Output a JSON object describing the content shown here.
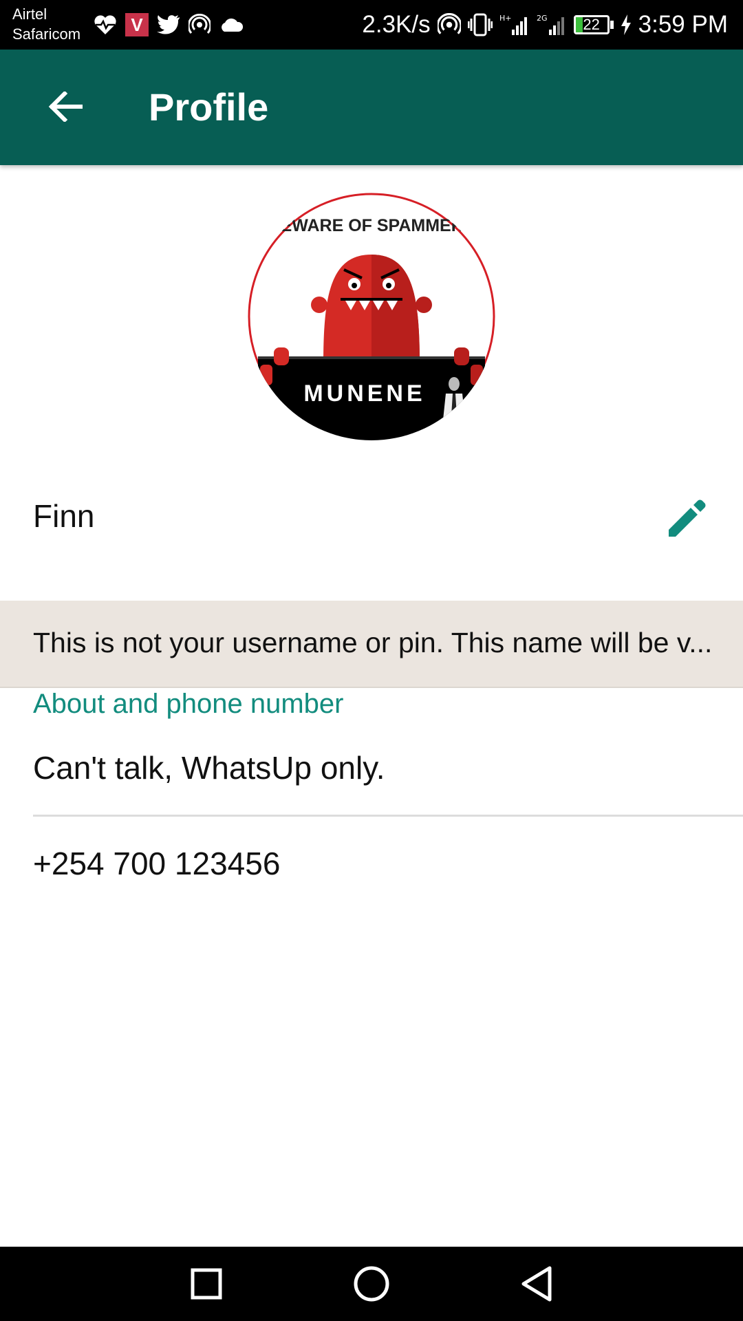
{
  "status_bar": {
    "carrier_1": "Airtel",
    "carrier_2": "Safaricom",
    "net_speed": "2.3K/s",
    "battery": "22",
    "battery_level_percent": 22,
    "time": "3:59 PM",
    "icons": [
      "heart-rate-icon",
      "v-app-icon",
      "twitter-icon",
      "hotspot-icon",
      "cloud-icon",
      "hotspot-icon",
      "vibrate-icon",
      "signal-hplus-icon",
      "signal-2g-icon",
      "battery-icon",
      "charging-icon"
    ]
  },
  "app_bar": {
    "title": "Profile",
    "background": "#075e54"
  },
  "avatar": {
    "banner_text": "BEWARE OF SPAMMERS",
    "sign_text": "MUNENE"
  },
  "profile": {
    "name": "Finn",
    "notice": "This is not your username or pin. This name will be v...",
    "section_title": "About and phone number",
    "about": "Can't talk, WhatsUp only.",
    "phone": "+254 700 123456"
  },
  "colors": {
    "accent": "#128c7e",
    "header": "#075e54",
    "notice_bg": "#ebe5df"
  }
}
